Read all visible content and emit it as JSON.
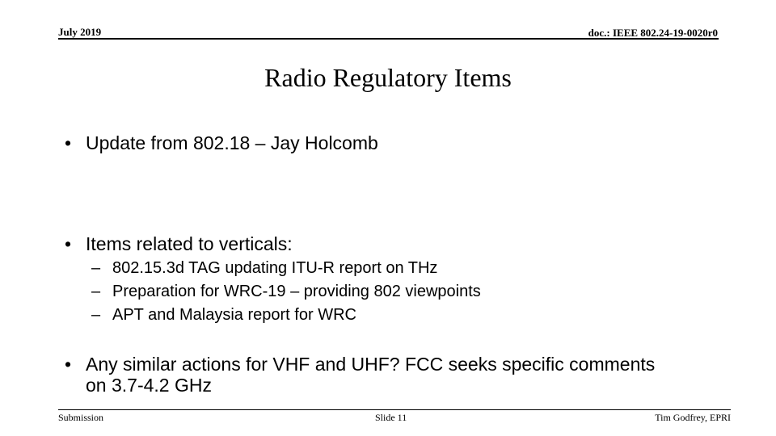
{
  "header": {
    "date": "July 2019",
    "doc_id": "doc.: IEEE 802.24-19-0020r0"
  },
  "slide": {
    "title": "Radio Regulatory Items",
    "bullet_glyph": "•",
    "dash_glyph": "–",
    "bullets": [
      {
        "text": "Update from 802.18 – Jay Holcomb"
      },
      {
        "text": "Items related to verticals:"
      },
      {
        "text": "Any similar actions for VHF and UHF?  FCC seeks specific comments on 3.7-4.2 GHz"
      }
    ],
    "sub_bullets": [
      {
        "text": "802.15.3d TAG updating ITU-R report on THz"
      },
      {
        "text": "Preparation for WRC-19 – providing 802 viewpoints"
      },
      {
        "text": "APT and Malaysia report for WRC"
      }
    ]
  },
  "footer": {
    "left": "Submission",
    "center": "Slide 11",
    "right": "Tim Godfrey, EPRI"
  }
}
